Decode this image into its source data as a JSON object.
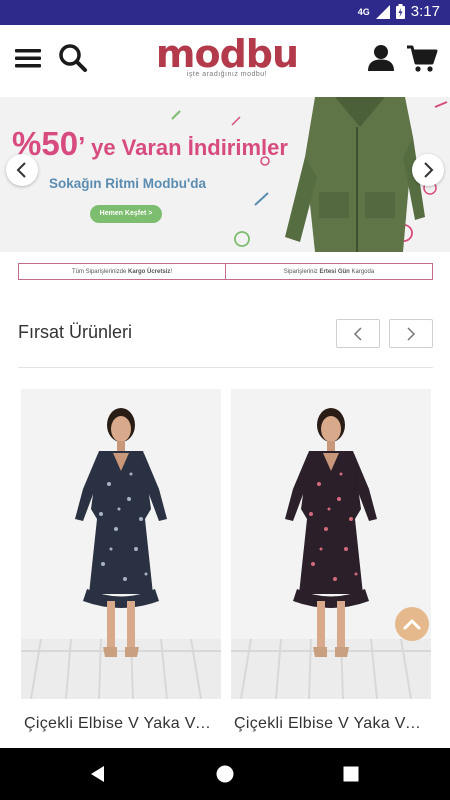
{
  "status_bar": {
    "network": "4G",
    "time": "3:17",
    "icons": [
      "signal-icon",
      "battery-icon"
    ]
  },
  "header": {
    "logo_text": "modbu",
    "logo_tagline": "işte aradığınız modbu!",
    "icons": [
      "menu-icon",
      "search-icon",
      "user-icon",
      "cart-icon"
    ]
  },
  "banner": {
    "discount": "%50",
    "headline_rest": "ye Varan İndirimler",
    "subheadline": "Sokağın Ritmi Modbu'da",
    "cta_label": "Hemen Keşfet >"
  },
  "info_strip": {
    "left_prefix": "Tüm Siparişlerinizde ",
    "left_bold": "Kargo Ücretsiz",
    "left_suffix": " !",
    "right_prefix": "Siparişleriniz ",
    "right_bold": "Ertesi Gün",
    "right_suffix": " Kargoda"
  },
  "section": {
    "title": "Fırsat Ürünleri"
  },
  "products": [
    {
      "name": "Çiçekli Elbise V Yaka Volanlı",
      "dress_color": "#2a3142",
      "print_color": "#a8b2c4"
    },
    {
      "name": "Çiçekli Elbise V Yaka Volanlı",
      "dress_color": "#2b1f2a",
      "print_color": "#d16a7a"
    }
  ],
  "colors": {
    "status_bar": "#2d2a8c",
    "brand": "#b23a4a",
    "accent_pink": "#d84b7f",
    "cta_green": "#7dbd6f",
    "fab": "#e6b98c"
  }
}
